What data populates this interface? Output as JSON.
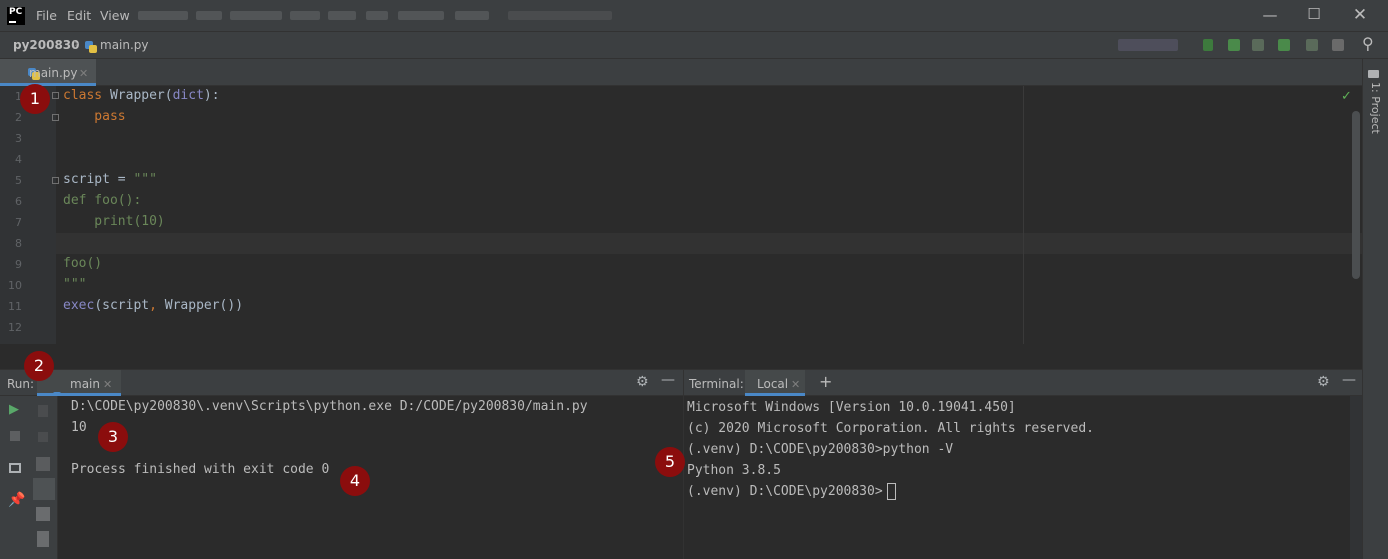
{
  "titlebar": {
    "app_icon_text": "PC",
    "menu": [
      "File",
      "Edit",
      "View"
    ],
    "window_controls": [
      "minimize-icon",
      "maximize-icon",
      "close-icon"
    ]
  },
  "navbar": {
    "project": "py200830",
    "file": "main.py"
  },
  "editor": {
    "tab_label": "main.py",
    "line_numbers": [
      "1",
      "2",
      "3",
      "4",
      "5",
      "6",
      "7",
      "8",
      "9",
      "10",
      "11",
      "12"
    ],
    "lines": [
      {
        "parts": [
          {
            "t": "class ",
            "c": "kw"
          },
          {
            "t": "Wrapper(",
            "c": ""
          },
          {
            "t": "dict",
            "c": "bi"
          },
          {
            "t": "):",
            "c": ""
          }
        ]
      },
      {
        "parts": [
          {
            "t": "    pass",
            "c": "kw"
          }
        ]
      },
      {
        "parts": []
      },
      {
        "parts": []
      },
      {
        "parts": [
          {
            "t": "script = ",
            "c": ""
          },
          {
            "t": "\"\"\"",
            "c": "str"
          }
        ]
      },
      {
        "parts": [
          {
            "t": "def foo():",
            "c": "str"
          }
        ]
      },
      {
        "parts": [
          {
            "t": "    print(10)",
            "c": "str"
          }
        ]
      },
      {
        "parts": []
      },
      {
        "parts": [
          {
            "t": "foo()",
            "c": "str"
          }
        ]
      },
      {
        "parts": [
          {
            "t": "\"\"\"",
            "c": "str"
          }
        ]
      },
      {
        "parts": [
          {
            "t": "exec",
            "c": "bi"
          },
          {
            "t": "(script",
            "c": ""
          },
          {
            "t": ", ",
            "c": "kw"
          },
          {
            "t": "Wrapper())",
            "c": ""
          }
        ]
      },
      {
        "parts": []
      }
    ],
    "status_check_icon": "checkmark-icon"
  },
  "right_sidebar": {
    "project_label": "1: Project"
  },
  "run_panel": {
    "label": "Run:",
    "tab_label": "main",
    "output": [
      "D:\\CODE\\py200830\\.venv\\Scripts\\python.exe D:/CODE/py200830/main.py",
      "10",
      "",
      "Process finished with exit code 0"
    ]
  },
  "terminal_panel": {
    "label": "Terminal:",
    "tab_label": "Local",
    "add_label": "+",
    "output": [
      "Microsoft Windows [Version 10.0.19041.450]",
      "(c) 2020 Microsoft Corporation. All rights reserved.",
      "(.venv) D:\\CODE\\py200830>python -V",
      "Python 3.8.5",
      "(.venv) D:\\CODE\\py200830>"
    ]
  },
  "annotations": [
    "1",
    "2",
    "3",
    "4",
    "5"
  ],
  "colors": {
    "annotation_badge": "#8b0d0d",
    "keyword": "#cc7832",
    "string": "#6a8759",
    "builtin": "#8888c6",
    "accent": "#4a88c7"
  }
}
